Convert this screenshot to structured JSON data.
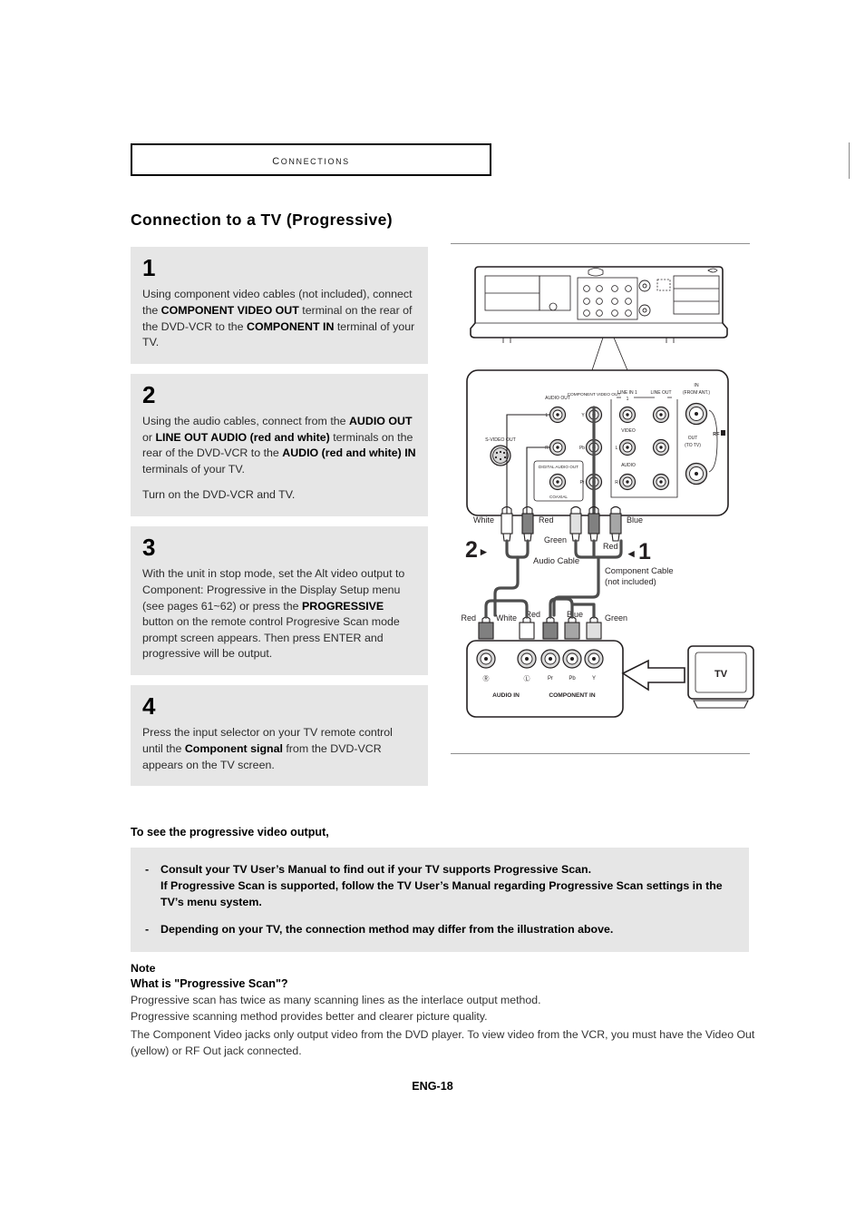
{
  "header": {
    "chapter": "Connections",
    "title": "Connection to a TV (Progressive)"
  },
  "steps": [
    {
      "number": "1",
      "paragraphs": [
        [
          {
            "t": "Using component video cables (not included), connect the ",
            "b": false
          },
          {
            "t": "COMPONENT VIDEO OUT",
            "b": true
          },
          {
            "t": " terminal on the rear of the DVD-VCR to the ",
            "b": false
          },
          {
            "t": "COMPONENT IN",
            "b": true
          },
          {
            "t": " terminal of your TV.",
            "b": false
          }
        ]
      ]
    },
    {
      "number": "2",
      "paragraphs": [
        [
          {
            "t": "Using the audio cables, connect from the ",
            "b": false
          },
          {
            "t": "AUDIO OUT",
            "b": true
          },
          {
            "t": " or ",
            "b": false
          },
          {
            "t": "LINE OUT AUDIO (red and white)",
            "b": true
          },
          {
            "t": " terminals on the rear of the DVD-VCR to the ",
            "b": false
          },
          {
            "t": "AUDIO (red and white) IN",
            "b": true
          },
          {
            "t": " terminals of your TV.",
            "b": false
          }
        ],
        [
          {
            "t": "Turn on the DVD-VCR and TV.",
            "b": false
          }
        ]
      ]
    },
    {
      "number": "3",
      "paragraphs": [
        [
          {
            "t": "With the unit in stop mode, set the Alt video output to Component: Progressive in the Display Setup menu (see pages 61~62) or press the ",
            "b": false
          },
          {
            "t": "PROGRESSIVE",
            "b": true
          },
          {
            "t": " button on the remote control Progresive Scan mode prompt screen appears. Then press ENTER and progressive will be output.",
            "b": false
          }
        ]
      ]
    },
    {
      "number": "4",
      "paragraphs": [
        [
          {
            "t": "Press the input selector on your TV remote control until the ",
            "b": false
          },
          {
            "t": "Component signal",
            "b": true
          },
          {
            "t": " from the DVD-VCR appears on the TV screen.",
            "b": false
          }
        ]
      ]
    }
  ],
  "to_see_heading": "To see the progressive video output,",
  "callout": {
    "dash": "-",
    "items": [
      "Consult your TV User’s Manual to find out if your TV supports Progressive Scan.\nIf Progressive Scan is supported, follow the TV User’s Manual regarding Progressive Scan settings in the TV’s menu system.",
      "Depending on your TV, the connection method may differ from the illustration above."
    ]
  },
  "note": {
    "title": "Note",
    "subtitle": "What is \"Progressive Scan\"?",
    "line1": "Progressive scan has twice as many scanning lines as the interlace output method.",
    "line2": "Progressive scanning method provides better and clearer picture quality.",
    "line3": "The Component Video jacks only output video from the DVD player. To view video from the VCR, you must have the Video Out (yellow) or RF Out jack connected."
  },
  "footer": {
    "page": "ENG-18"
  },
  "diagram": {
    "rear_panel": {
      "labels": {
        "svideo_out": "S-VIDEO OUT",
        "audio_out": "AUDIO OUT",
        "component_video_out": "COMPONENT VIDEO OUT",
        "line_in_1": "LINE IN 1",
        "line_out": "LINE OUT",
        "digital_audio_out": "DIGITAL AUDIO OUT",
        "coaxial": "COAXIAL",
        "video": "VIDEO",
        "audio": "AUDIO",
        "ant_in": "IN",
        "ant_in_sub": "(FROM ANT.)",
        "ant_out": "OUT",
        "ant_out_sub": "(TO TV)",
        "rf": "RF",
        "jack_l": "L",
        "jack_r": "R",
        "jack_y": "Y",
        "jack_pb": "Pb",
        "jack_pr": "Pr"
      }
    },
    "plugs_top": {
      "white": "White",
      "red_audio": "Red",
      "green": "Green",
      "red_component": "Red",
      "blue": "Blue"
    },
    "callouts": {
      "step2": "2",
      "step2_arrow": "▸",
      "step1": "1",
      "step1_arrow": "◂",
      "audio_cable": "Audio Cable",
      "component_cable_l1": "Component Cable",
      "component_cable_l2": "(not included)"
    },
    "tv_panel": {
      "plugs": {
        "red_audio": "Red",
        "white": "White",
        "red_component": "Red",
        "blue": "Blue",
        "green": "Green"
      },
      "jack_r": "Ⓡ",
      "jack_l": "Ⓛ",
      "jack_pr": "Pr",
      "jack_pb": "Pb",
      "jack_y": "Y",
      "audio_in": "AUDIO IN",
      "component_in": "COMPONENT IN",
      "tv": "TV"
    },
    "colors": {
      "white_plug": "#ffffff",
      "red_plug": "#808080",
      "green_plug": "#d9d9d9",
      "blue_plug": "#a6a6a6",
      "line": "#231f20"
    }
  }
}
